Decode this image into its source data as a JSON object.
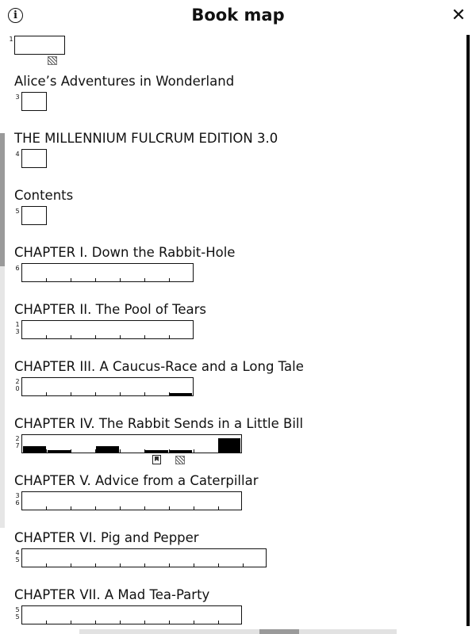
{
  "header": {
    "title": "Book map",
    "info_glyph": "i",
    "close_glyph": "✕"
  },
  "entries": [
    {
      "title": "",
      "page_label": "1"
    },
    {
      "title": "Alice’s Adventures in Wonderland",
      "page_label": "3"
    },
    {
      "title": "THE MILLENNIUM FULCRUM EDITION 3.0",
      "page_label": "4"
    },
    {
      "title": "Contents",
      "page_label": "5"
    },
    {
      "title": "CHAPTER I. Down the Rabbit-Hole",
      "page_label": "6"
    },
    {
      "title": "CHAPTER II. The Pool of Tears",
      "page_label": "13"
    },
    {
      "title": "CHAPTER III. A Caucus-Race and a Long Tale",
      "page_label": "20"
    },
    {
      "title": "CHAPTER IV. The Rabbit Sends in a Little Bill",
      "page_label": "27"
    },
    {
      "title": "CHAPTER V. Advice from a Caterpillar",
      "page_label": "36"
    },
    {
      "title": "CHAPTER VI. Pig and Pepper",
      "page_label": "45"
    },
    {
      "title": "CHAPTER VII. A Mad Tea-Party",
      "page_label": "55"
    }
  ],
  "icons": {
    "info": "info-icon",
    "close": "close-icon",
    "bookmark": "bookmark-icon",
    "hatched": "highlight-marker-icon"
  }
}
